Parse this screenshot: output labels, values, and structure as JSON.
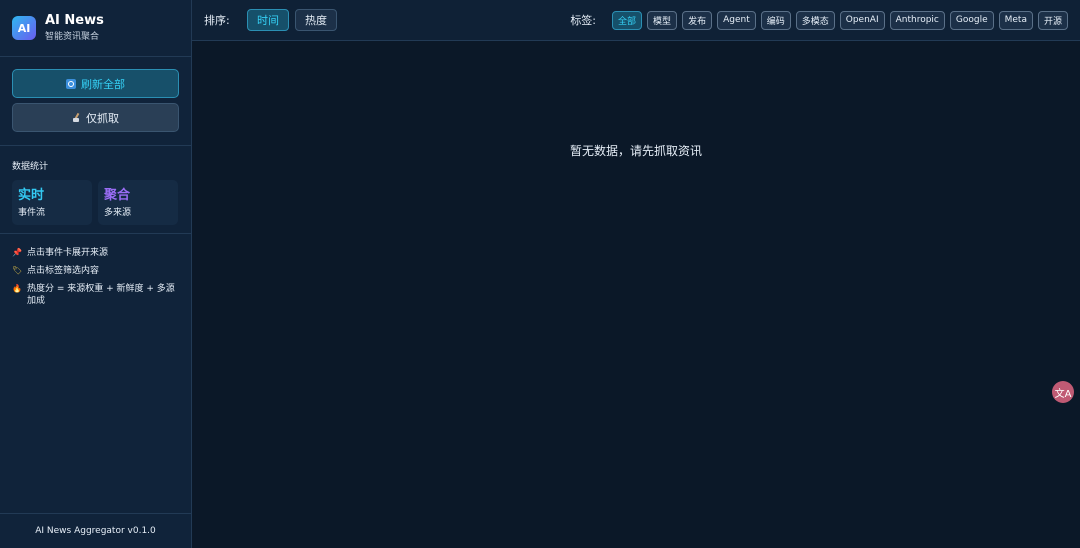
{
  "brand": {
    "logo": "AI",
    "title": "AI News",
    "subtitle": "智能资讯聚合"
  },
  "actions": {
    "refresh_all": "刷新全部",
    "fetch_only": "仅抓取"
  },
  "stats": {
    "title": "数据统计",
    "cards": [
      {
        "value": "实时",
        "label": "事件流",
        "color": "#33c9f2"
      },
      {
        "value": "聚合",
        "label": "多来源",
        "color": "#9a6df5"
      }
    ]
  },
  "tips": [
    {
      "icon": "pin-icon",
      "text": "点击事件卡展开来源"
    },
    {
      "icon": "tag-icon",
      "text": "点击标签筛选内容"
    },
    {
      "icon": "fire-icon",
      "text": "热度分 = 来源权重 + 新鲜度 + 多源加成"
    }
  ],
  "footer": "AI News Aggregator v0.1.0",
  "toolbar": {
    "sort_label": "排序:",
    "sort_options": [
      {
        "label": "时间",
        "active": true
      },
      {
        "label": "热度",
        "active": false
      }
    ],
    "tag_label": "标签:",
    "tags": [
      {
        "label": "全部",
        "active": true
      },
      {
        "label": "模型"
      },
      {
        "label": "发布"
      },
      {
        "label": "Agent"
      },
      {
        "label": "编码"
      },
      {
        "label": "多模态"
      },
      {
        "label": "OpenAI"
      },
      {
        "label": "Anthropic"
      },
      {
        "label": "Google"
      },
      {
        "label": "Meta"
      },
      {
        "label": "开源"
      }
    ]
  },
  "main": {
    "empty_message": "暂无数据，请先抓取资讯"
  },
  "fab": {
    "icon": "translate-icon",
    "glyph": "文A"
  },
  "colors": {
    "accent": "#35d0f5",
    "purple": "#9a6df5",
    "background": "#0b1828",
    "sidebar": "#10233a"
  }
}
